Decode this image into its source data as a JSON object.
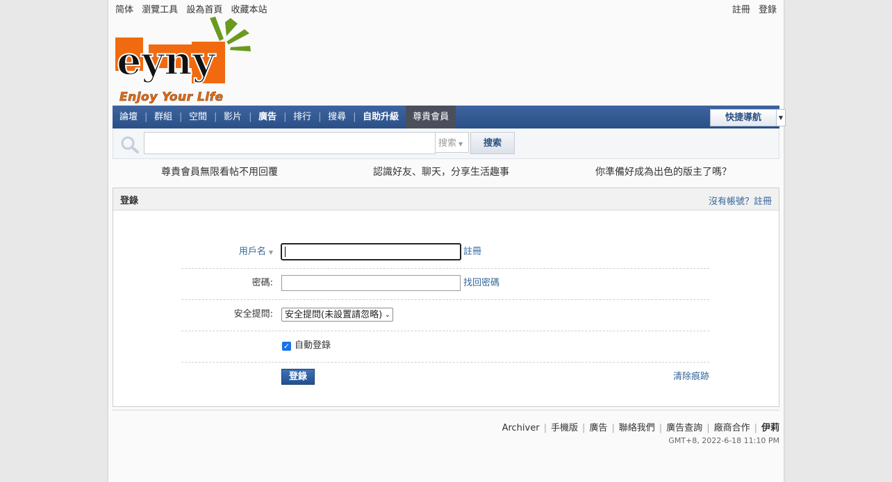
{
  "toplinks": {
    "left": [
      "简体",
      "瀏覽工具",
      "設為首頁",
      "收藏本站"
    ],
    "right": [
      "註冊",
      "登錄"
    ]
  },
  "logo": {
    "text": "eyny",
    "tagline": "Enjoy Your Life",
    "colors": {
      "orange": "#f26a10",
      "green": "#6a9a1f"
    }
  },
  "nav": {
    "items": [
      "論壇",
      "群組",
      "空間",
      "影片",
      "廣告",
      "排行",
      "搜尋",
      "自助升級",
      "尊貴會員"
    ],
    "quick_nav": "快捷導航",
    "colors": {
      "bar": "#2f558e",
      "active": "#4b4f5c"
    }
  },
  "search": {
    "type_label": "搜索",
    "button": "搜索",
    "placeholder": ""
  },
  "promos": [
    "尊貴會員無限看帖不用回覆",
    "認識好友、聊天，分享生活趣事",
    "你準備好成為出色的版主了嗎？"
  ],
  "login": {
    "title": "登錄",
    "register_link": "沒有帳號？註冊",
    "username_label": "用戶名",
    "username_after": "註冊",
    "password_label": "密碼:",
    "password_after": "找回密碼",
    "question_label": "安全提問:",
    "question_selected": "安全提問(未設置請忽略)",
    "remember_label": "自動登錄",
    "remember_checked": true,
    "submit": "登錄",
    "clear": "清除痕跡"
  },
  "footer": {
    "links": [
      "Archiver",
      "手機版",
      "廣告",
      "聯絡我們",
      "廣告查詢",
      "廠商合作",
      "伊莉"
    ],
    "time": "GMT+8, 2022-6-18 11:10 PM"
  }
}
